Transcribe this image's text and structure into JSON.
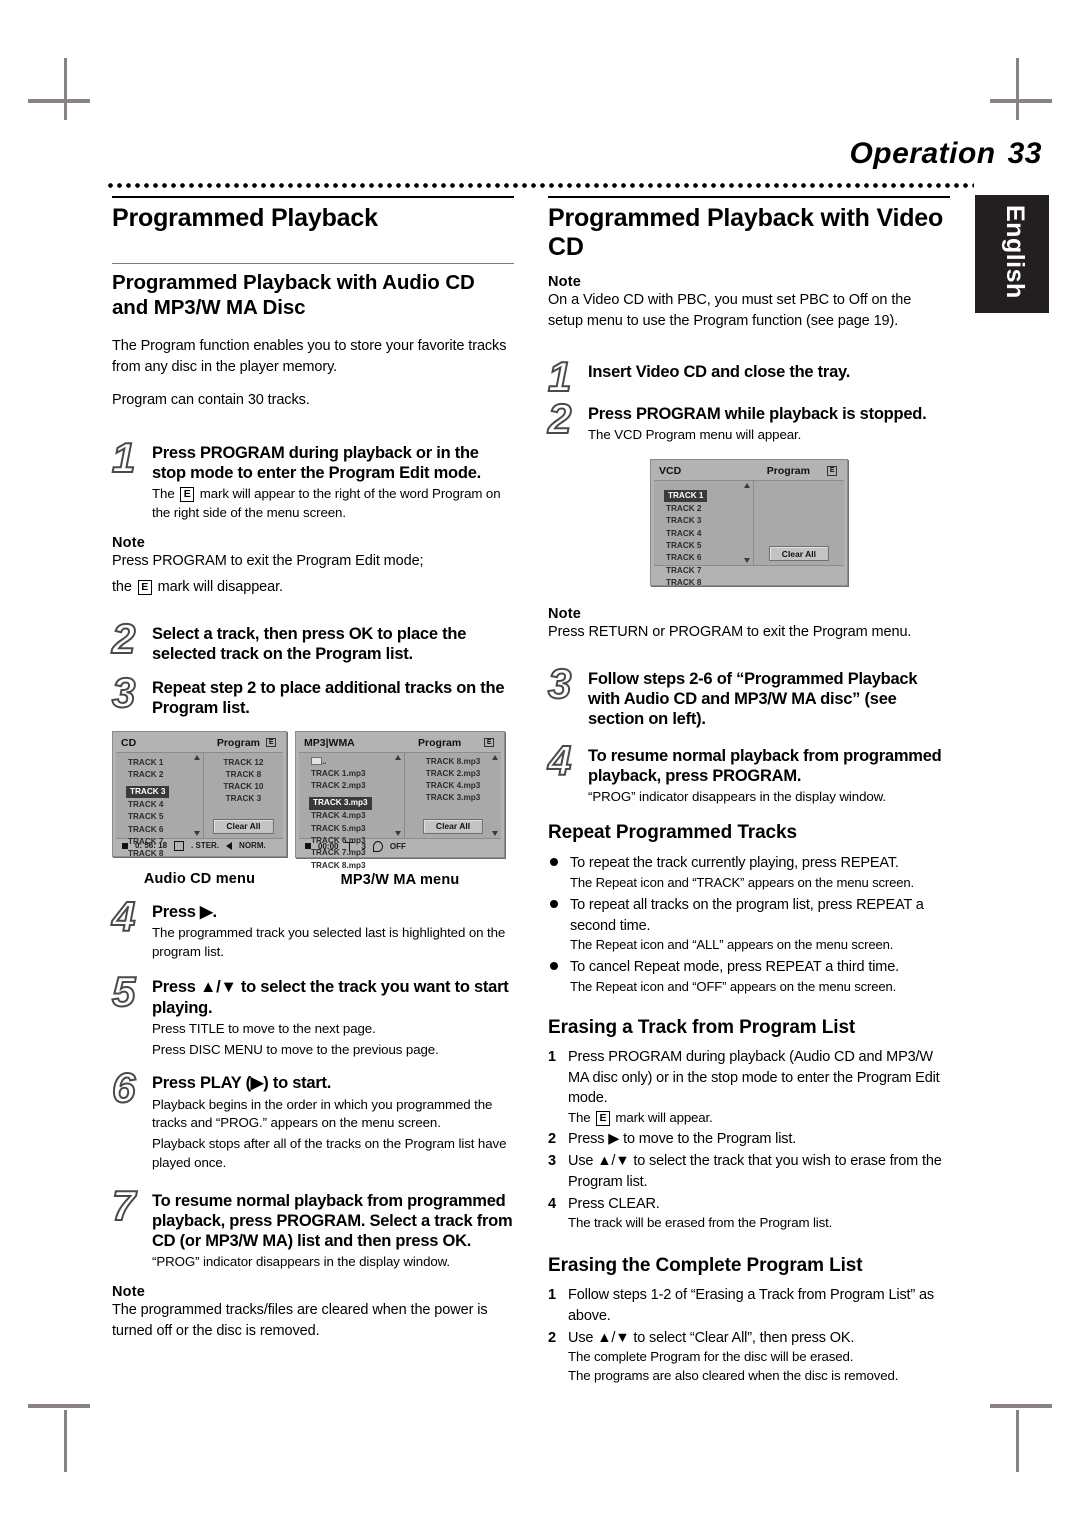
{
  "header": {
    "section": "Operation",
    "page_number": "33",
    "lang_tab": "English"
  },
  "left": {
    "section_title": "Programmed Playback",
    "sub_title": "Programmed Playback with Audio CD and MP3/W MA Disc",
    "intro1": "The Program function enables you to store your favorite tracks from any disc in the player memory.",
    "intro2": "Program can contain 30 tracks.",
    "step1": {
      "num": "1",
      "title": "Press PROGRAM during playback or in the stop mode to enter the Program Edit mode.",
      "desc_a": "The",
      "desc_b": "mark will appear to the right of the word Program on the right side of the menu screen."
    },
    "note1": {
      "heading": "Note",
      "line1": "Press PROGRAM to exit the Program Edit mode;",
      "line2_a": "the",
      "line2_b": "mark will disappear."
    },
    "step2": {
      "num": "2",
      "title": "Select a track, then press OK to place the selected track on the Program list."
    },
    "step3": {
      "num": "3",
      "title": "Repeat step 2 to place additional tracks on the Program list."
    },
    "step4": {
      "num": "4",
      "title": "Press ▶.",
      "desc": "The programmed track you selected last is highlighted on the program list."
    },
    "step5": {
      "num": "5",
      "title": "Press ▲/▼ to select the track you want to start playing.",
      "desc1": "Press TITLE to move to the next page.",
      "desc2": "Press DISC MENU to move to the previous page."
    },
    "step6": {
      "num": "6",
      "title": "Press PLAY (▶) to start.",
      "desc1": "Playback begins in the order in which you programmed the tracks and “PROG.” appears on the menu screen.",
      "desc2": "Playback stops after all of the tracks on the Program list have played once."
    },
    "step7": {
      "num": "7",
      "title": "To resume normal playback from programmed playback, press PROGRAM. Select a track from CD (or MP3/W MA) list and then press OK.",
      "desc": "“PROG” indicator disappears in the display window."
    },
    "note2": {
      "heading": "Note",
      "text": "The programmed tracks/files are cleared when the power is turned off or the disc is removed."
    }
  },
  "right": {
    "section_title": "Programmed Playback with Video CD",
    "note1": {
      "heading": "Note",
      "text": "On a Video CD with PBC, you must set PBC to Off on the setup menu to use the Program function (see page 19)."
    },
    "step1": {
      "num": "1",
      "title": "Insert Video CD and close the tray."
    },
    "step2": {
      "num": "2",
      "title": "Press PROGRAM while playback is stopped.",
      "desc": "The VCD Program menu will appear."
    },
    "note2": {
      "heading": "Note",
      "text": "Press RETURN or PROGRAM to exit the Program menu."
    },
    "step3": {
      "num": "3",
      "title": "Follow steps 2-6 of “Programmed Playback with Audio CD and MP3/W MA disc” (see section on left)."
    },
    "step4": {
      "num": "4",
      "title": "To resume normal playback from programmed playback, press PROGRAM.",
      "desc": "“PROG” indicator disappears in the display window."
    },
    "repeat": {
      "heading": "Repeat Programmed Tracks",
      "items": [
        {
          "main": "To repeat the track currently playing, press REPEAT.",
          "sub": "The Repeat icon and “TRACK” appears on the menu screen."
        },
        {
          "main": "To repeat all tracks on the program list, press REPEAT a second time.",
          "sub": "The Repeat icon and “ALL” appears on the menu screen."
        },
        {
          "main": "To cancel Repeat mode, press REPEAT a third time.",
          "sub": "The Repeat icon and “OFF” appears on the menu screen."
        }
      ]
    },
    "erase_track": {
      "heading": "Erasing a Track from Program List",
      "i1_n": "1",
      "i1_a": "Press PROGRAM during playback  (Audio CD and MP3/W MA disc only) or in the stop mode to enter the Program Edit mode.",
      "i1_sub_a": "The",
      "i1_sub_b": "mark will appear.",
      "i2_n": "2",
      "i2": "Press ▶ to move to the Program list.",
      "i3_n": "3",
      "i3": "Use ▲/▼ to select the track that you wish to erase from the Program list.",
      "i4_n": "4",
      "i4": "Press CLEAR.",
      "i4_sub": "The track will be erased from the Program list."
    },
    "erase_all": {
      "heading": "Erasing the Complete Program List",
      "i1_n": "1",
      "i1": "Follow steps 1-2 of “Erasing a Track from Program List” as above.",
      "i2_n": "2",
      "i2": "Use ▲/▼ to select “Clear All”, then press OK.",
      "i2_sub1": "The complete Program for the disc will be erased.",
      "i2_sub2": "The programs are also cleared when the disc is removed."
    }
  },
  "osd": {
    "cd_menu": {
      "title": "CD",
      "program_label": "Program",
      "emark": "E",
      "tracks": [
        "TRACK 1",
        "TRACK 2",
        "TRACK 3",
        "TRACK 4",
        "TRACK 5",
        "TRACK 6",
        "TRACK 7",
        "TRACK 8"
      ],
      "selected": "TRACK 3",
      "program_tracks": [
        "TRACK 12",
        "TRACK 8",
        "TRACK 10",
        "TRACK 3"
      ],
      "clear_all": "Clear All",
      "status_time": "0: 56: 18",
      "status_audio": ". STER.",
      "status_mode": "NORM.",
      "caption": "Audio CD menu"
    },
    "mp3_menu": {
      "title": "MP3|WMA",
      "program_label": "Program",
      "emark": "E",
      "folder_row": "..",
      "tracks": [
        "TRACK 1.mp3",
        "TRACK 2.mp3",
        "TRACK 3.mp3",
        "TRACK 4.mp3",
        "TRACK 5.mp3",
        "TRACK 6.mp3",
        "TRACK 7.mp3",
        "TRACK 8.mp3"
      ],
      "selected": "TRACK 3.mp3",
      "program_tracks": [
        "TRACK 8.mp3",
        "TRACK 2.mp3",
        "TRACK 4.mp3",
        "TRACK 3.mp3"
      ],
      "clear_all": "Clear All",
      "status_time": "00:00",
      "status_count": "3",
      "status_repeat": "OFF",
      "caption": "MP3/W MA menu"
    },
    "vcd_menu": {
      "title": "VCD",
      "program_label": "Program",
      "emark": "E",
      "tracks": [
        "TRACK 1",
        "TRACK 2",
        "TRACK 3",
        "TRACK 4",
        "TRACK 5",
        "TRACK 6",
        "TRACK 7",
        "TRACK 8"
      ],
      "selected": "TRACK 1",
      "program_tracks": [],
      "clear_all": "Clear All"
    }
  }
}
